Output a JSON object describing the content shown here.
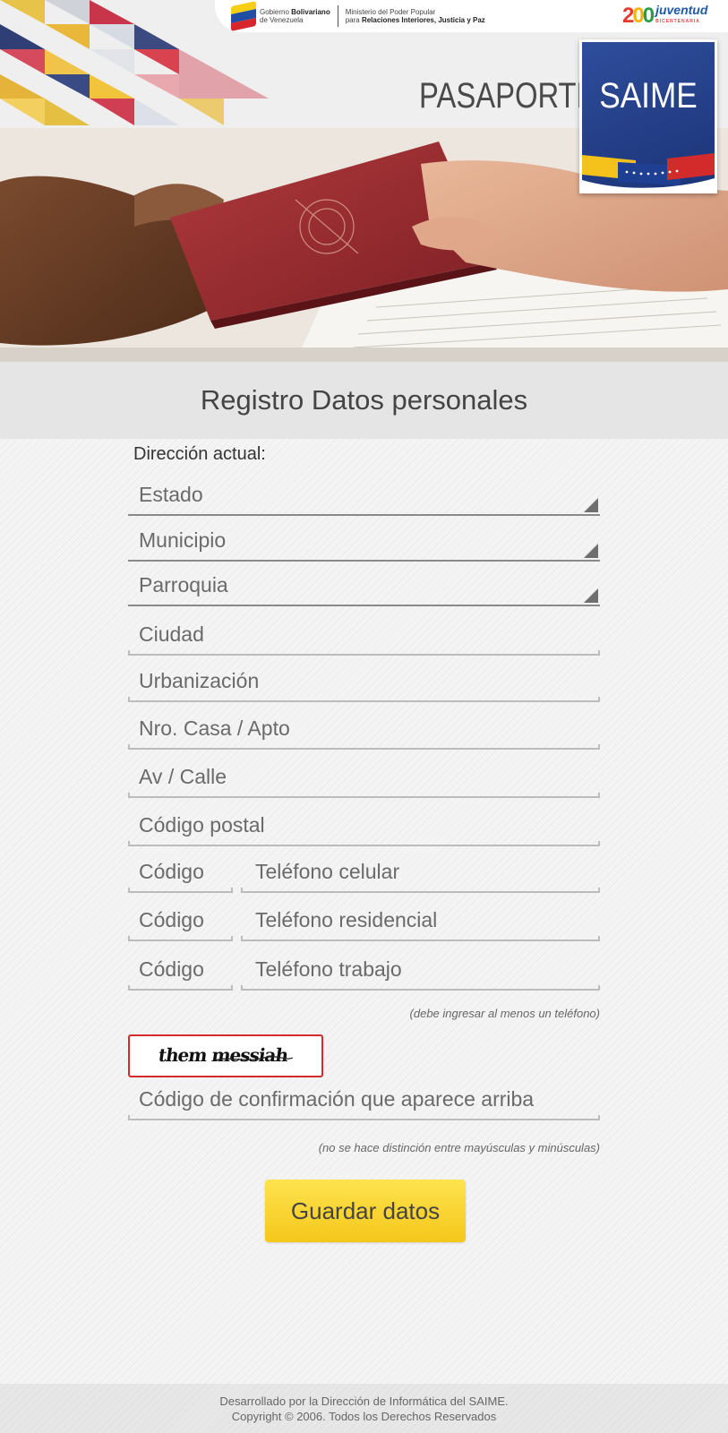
{
  "header": {
    "gov_line1_prefix": "Gobierno ",
    "gov_line1_bold": "Bolivariano",
    "gov_line2": "de Venezuela",
    "ministry_line1": "Ministerio del Poder Popular",
    "ministry_line2_prefix": "para ",
    "ministry_line2_bold": "Relaciones Interiores, Justicia y Paz",
    "juventud_word": "juventud",
    "juventud_sub": "BICENTENARIA",
    "pasaporte": "PASAPORTE",
    "saime": "SAIME"
  },
  "page": {
    "title": "Registro Datos personales"
  },
  "form": {
    "section_label": "Dirección actual:",
    "selects": {
      "estado": "Estado",
      "municipio": "Municipio",
      "parroquia": "Parroquia"
    },
    "inputs": {
      "ciudad": "Ciudad",
      "urbanizacion": "Urbanización",
      "nro_casa": "Nro. Casa / Apto",
      "av_calle": "Av / Calle",
      "codigo_postal": "Código postal"
    },
    "phones": {
      "code_placeholder": "Código",
      "celular": "Teléfono celular",
      "residencial": "Teléfono residencial",
      "trabajo": "Teléfono trabajo"
    },
    "phone_hint": "(debe ingresar al menos un teléfono)",
    "captcha_text": "them   messiah",
    "captcha_input": "Código de confirmación que aparece arriba",
    "captcha_hint": "(no se hace distinción entre mayúsculas y minúsculas)",
    "save_label": "Guardar datos"
  },
  "footer": {
    "line1": "Desarrollado por la Dirección de Informática del SAIME.",
    "line2": "Copyright © 2006. Todos los Derechos Reservados"
  },
  "colors": {
    "button": "#f5c71a",
    "captcha_border": "#d52b2b",
    "saime_blue": "#1c3478"
  }
}
